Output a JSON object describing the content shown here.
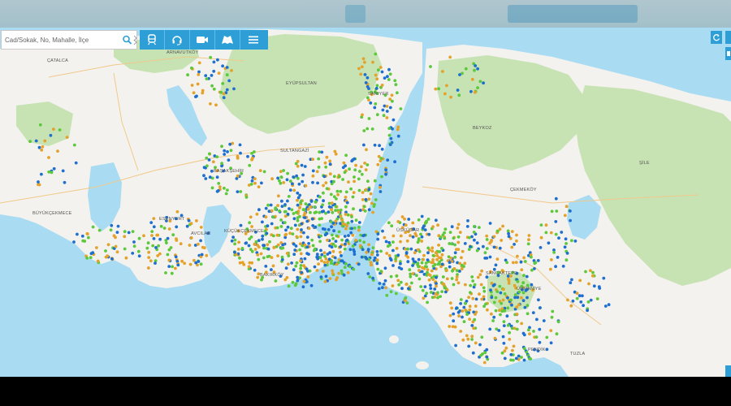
{
  "search": {
    "placeholder": "Cad/Sokak, No, Mahalle, İlçe"
  },
  "toolbar": {
    "tools": [
      {
        "icon": "train-icon"
      },
      {
        "icon": "headset-icon"
      },
      {
        "icon": "video-camera-icon"
      },
      {
        "icon": "map-book-icon"
      },
      {
        "icon": "menu-icon"
      }
    ]
  },
  "right_controls": [
    {
      "icon": "refresh-icon"
    },
    {
      "icon": "layers-icon"
    }
  ],
  "places": [
    {
      "name": "ÇATALCA"
    },
    {
      "name": "ARNAVUTKÖY"
    },
    {
      "name": "EYÜPSULTAN"
    },
    {
      "name": "SARIYER"
    },
    {
      "name": "BEYKOZ"
    },
    {
      "name": "ŞİLE"
    },
    {
      "name": "SULTANGAZİ"
    },
    {
      "name": "BAŞAKŞEHİR"
    },
    {
      "name": "BÜYÜKÇEKMECE"
    },
    {
      "name": "ESENYURT"
    },
    {
      "name": "AVCILAR"
    },
    {
      "name": "ÇEKMEKÖY"
    },
    {
      "name": "SANCAKTEPE"
    },
    {
      "name": "ÜMRANİYE"
    },
    {
      "name": "TUZLA"
    },
    {
      "name": "PENDİK"
    },
    {
      "name": "ÜSKÜDAR"
    },
    {
      "name": "BAKIRKÖY"
    },
    {
      "name": "KÜÇÜKÇEKMECE"
    }
  ],
  "colors": {
    "sea": "#a9dcf2",
    "land": "#f4f2ee",
    "forest": "#c7e3b4",
    "accent": "#2d9fd6",
    "point_blue": "#1e6fd0",
    "point_orange": "#e4a22a",
    "point_green": "#5bc93b"
  }
}
